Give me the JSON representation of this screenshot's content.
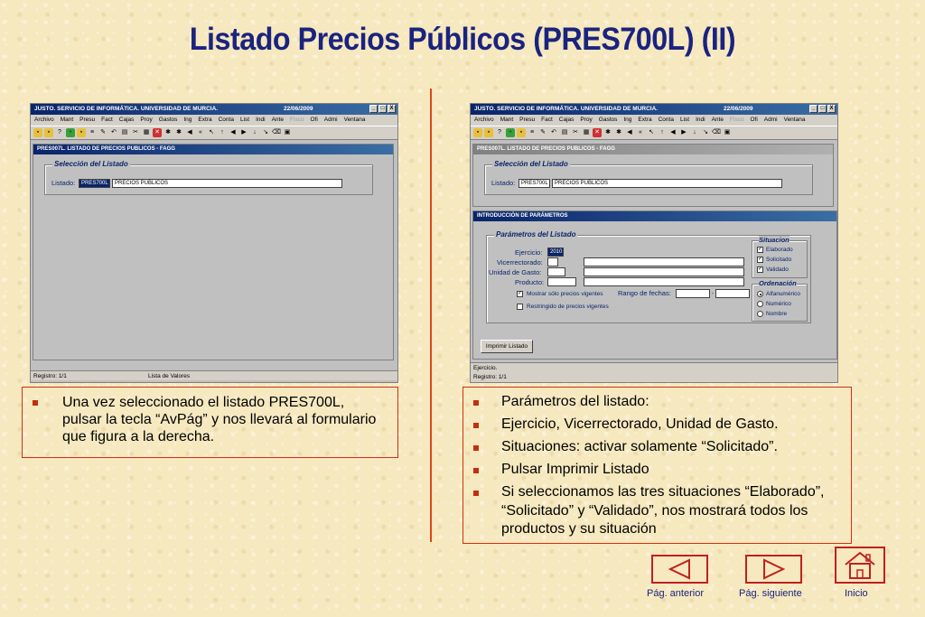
{
  "slide": {
    "title": "Listado Precios Públicos (PRES700L) (II)"
  },
  "app": {
    "window_title": "JUSTO. SERVICIO DE INFORMÁTICA. UNIVERSIDAD DE MURCIA.",
    "date": "22/06/2009",
    "window_controls": [
      "_",
      "□",
      "X"
    ],
    "menu": [
      "Archivo",
      "Mant",
      "Presu",
      "Fact",
      "Cajas",
      "Proy",
      "Gastos",
      "Ing",
      "Extra",
      "Conta",
      "List",
      "Indi",
      "Ante",
      "Fisco",
      "Ofi",
      "Admi",
      "Ventana"
    ],
    "menu_disabled": "Fisco"
  },
  "left_screen": {
    "form_title": "PRES007L. LISTADO DE PRECIOS PUBLICOS - FAGG",
    "group_label": "Selección del Listado",
    "listado_label": "Listado:",
    "listado_code": "PRES700L",
    "listado_desc": "PRECIOS PUBLICOS",
    "status_record": "Registro: 1/1",
    "status_values": "Lista de Valores"
  },
  "right_screen": {
    "form_title": "PRES007L. LISTADO DE PRECIOS PUBLICOS - FAGG",
    "group_label": "Selección del Listado",
    "listado_label": "Listado:",
    "listado_code": "PRES700L",
    "listado_desc": "PRECIOS PUBLICOS",
    "params_title": "INTRODUCCIÓN DE PARÁMETROS",
    "params_group": "Parámetros del Listado",
    "ejercicio_label": "Ejercicio:",
    "ejercicio_value": "2010",
    "vicerrectorado_label": "Vicerrectorado:",
    "unidad_label": "Unidad de Gasto:",
    "producto_label": "Producto:",
    "mostrar_label": "Mostrar sólo precios vigentes",
    "restringido_label": "Restringido de precios vigentes",
    "rango_label": "Rango de fechas:",
    "rango_sep": "-",
    "situacion_title": "Situacion",
    "situaciones": [
      "Elaborado",
      "Solicitado",
      "Validado"
    ],
    "ordenacion_title": "Ordenación",
    "ordenaciones": [
      "Alfanumérico",
      "Numérico",
      "Nombre"
    ],
    "print_button": "Imprimir Listado",
    "status_line1": "Ejercicio.",
    "status_line2": "Registro: 1/1"
  },
  "left_bullets": [
    "Una vez seleccionado el listado PRES700L, pulsar la tecla “AvPág” y nos llevará al formulario que figura a la derecha."
  ],
  "right_bullets": [
    "Parámetros del listado:",
    "Ejercicio, Vicerrectorado, Unidad de Gasto.",
    "Situaciones: activar solamente “Solicitado”.",
    "Pulsar Imprimir Listado",
    "Si seleccionamos las tres situaciones “Elaborado”, “Solicitado” y “Validado”, nos mostrará todos los productos y su situación"
  ],
  "nav": {
    "prev": "Pág. anterior",
    "next": "Pág. siguiente",
    "home": "Inicio"
  },
  "colors": {
    "title": "#1a237e",
    "accent": "#c02020",
    "background": "#f6e8bf"
  }
}
